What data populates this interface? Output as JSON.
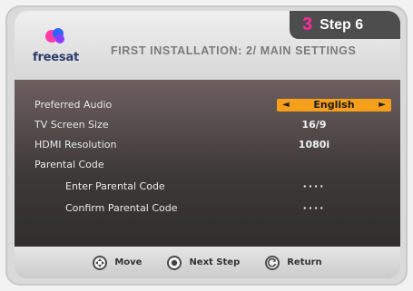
{
  "badge": {
    "number": "3",
    "text": "Step 6",
    "number_color": "#ff2aa0"
  },
  "header": {
    "logo_text": "freesat",
    "title": "FIRST INSTALLATION: 2/ MAIN SETTINGS"
  },
  "settings": {
    "preferred_audio": {
      "label": "Preferred Audio",
      "value": "English"
    },
    "tv_screen_size": {
      "label": "TV Screen Size",
      "value": "16/9"
    },
    "hdmi_resolution": {
      "label": "HDMI Resolution",
      "value": "1080i"
    },
    "parental_code": {
      "label": "Parental Code"
    },
    "enter_parental_code": {
      "label": "Enter Parental Code",
      "value": "····"
    },
    "confirm_parental_code": {
      "label": "Confirm Parental Code",
      "value": "····"
    }
  },
  "footer": {
    "move": "Move",
    "next_step": "Next Step",
    "return": "Return"
  },
  "colors": {
    "accent_orange": "#f59f1a",
    "badge_bg": "#4d4d4d",
    "menu_bg": "#3f3a3a"
  },
  "icons": [
    "freesat-logo",
    "left-arrow-icon",
    "right-arrow-icon",
    "navigation-pad-icon",
    "ok-button-icon",
    "return-button-icon"
  ]
}
